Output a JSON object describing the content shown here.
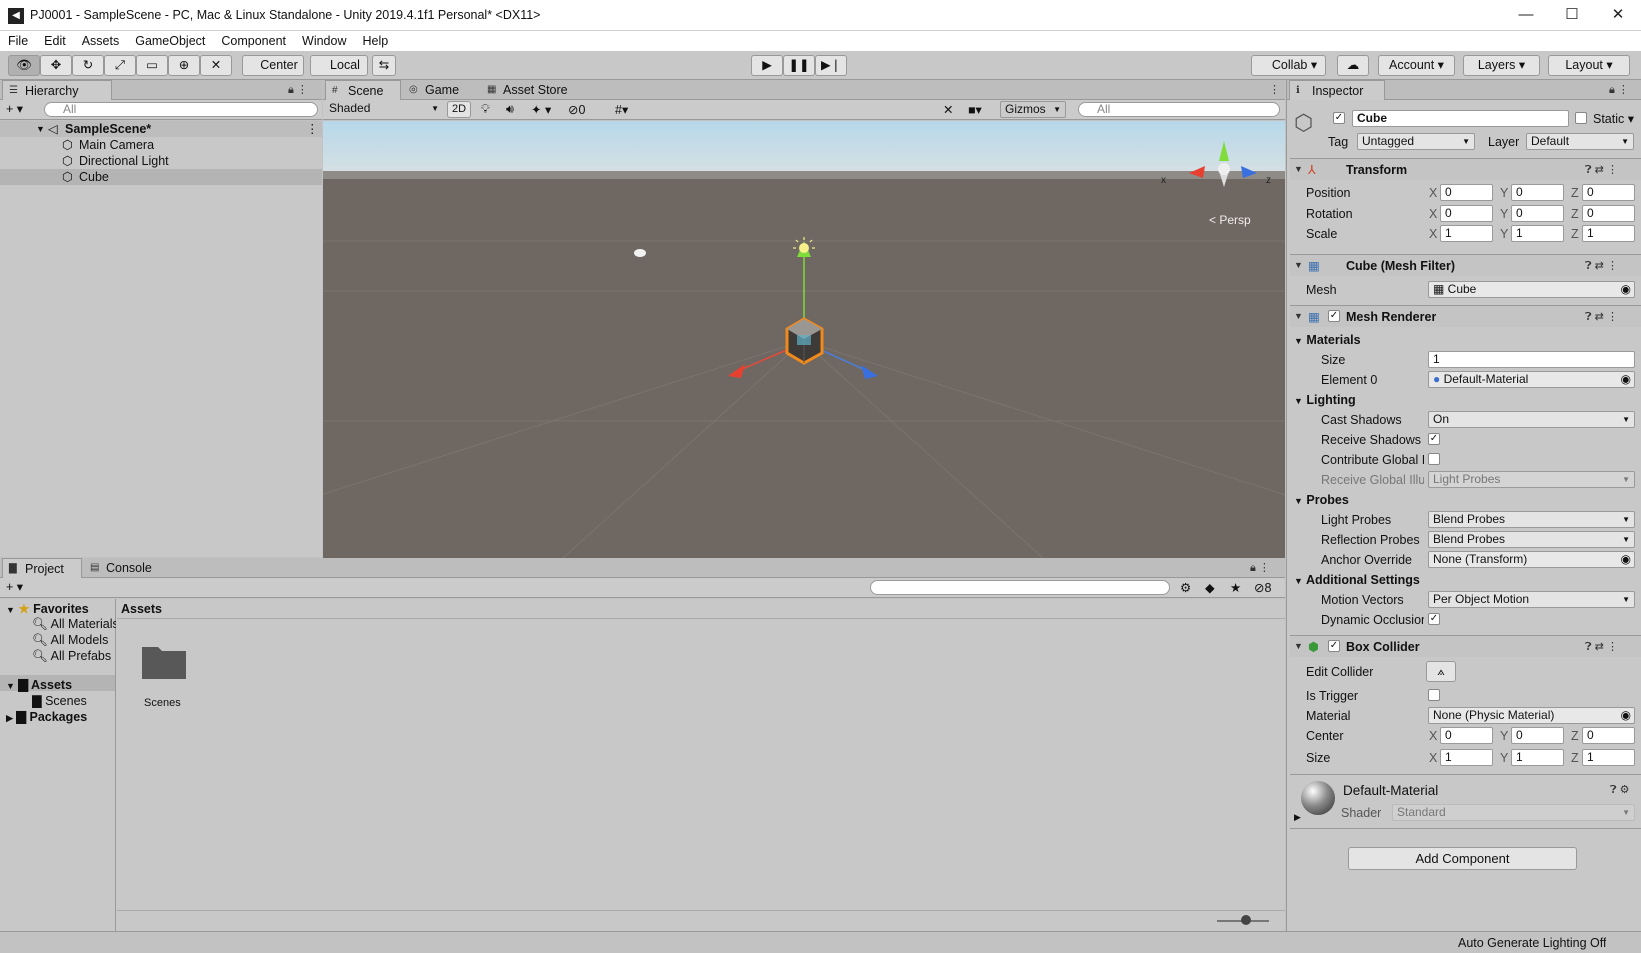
{
  "window": {
    "title": "PJ0001 - SampleScene - PC, Mac & Linux Standalone - Unity 2019.4.1f1 Personal* <DX11>",
    "minimize": "—",
    "maximize": "☐",
    "close": "✕"
  },
  "menu": [
    "File",
    "Edit",
    "Assets",
    "GameObject",
    "Component",
    "Window",
    "Help"
  ],
  "toolbar": {
    "pivot": "Center",
    "space": "Local",
    "collab": "Collab",
    "account": "Account",
    "layers": "Layers",
    "layout": "Layout"
  },
  "hierarchy": {
    "tab": "Hierarchy",
    "search_placeholder": "All",
    "scene": "SampleScene*",
    "items": [
      "Main Camera",
      "Directional Light",
      "Cube"
    ]
  },
  "scene_view": {
    "tabs": [
      "Scene",
      "Game",
      "Asset Store"
    ],
    "shading": "Shaded",
    "mode2d": "2D",
    "hidden_count": "0",
    "gizmos": "Gizmos",
    "search_placeholder": "All",
    "persp": "< Persp",
    "axis_x": "x",
    "axis_z": "z"
  },
  "project": {
    "tabs": [
      "Project",
      "Console"
    ],
    "favorites": "Favorites",
    "favorite_items": [
      "All Materials",
      "All Models",
      "All Prefabs"
    ],
    "assets_root": "Assets",
    "assets_children": [
      "Scenes"
    ],
    "packages": "Packages",
    "breadcrumb": "Assets",
    "folders": [
      "Scenes"
    ],
    "badge": "8"
  },
  "inspector": {
    "tab": "Inspector",
    "object_name": "Cube",
    "static": "Static",
    "tag_label": "Tag",
    "tag": "Untagged",
    "layer_label": "Layer",
    "layer": "Default",
    "transform": {
      "title": "Transform",
      "rows": [
        {
          "label": "Position",
          "x": "0",
          "y": "0",
          "z": "0"
        },
        {
          "label": "Rotation",
          "x": "0",
          "y": "0",
          "z": "0"
        },
        {
          "label": "Scale",
          "x": "1",
          "y": "1",
          "z": "1"
        }
      ]
    },
    "mesh_filter": {
      "title": "Cube (Mesh Filter)",
      "mesh_label": "Mesh",
      "mesh": "Cube"
    },
    "mesh_renderer": {
      "title": "Mesh Renderer",
      "materials": "Materials",
      "size_label": "Size",
      "size": "1",
      "element0_label": "Element 0",
      "element0": "Default-Material",
      "lighting": "Lighting",
      "cast_shadows_label": "Cast Shadows",
      "cast_shadows": "On",
      "receive_shadows_label": "Receive Shadows",
      "contribute_gi_label": "Contribute Global I",
      "receive_gi_label": "Receive Global Illu",
      "receive_gi": "Light Probes",
      "probes": "Probes",
      "light_probes_label": "Light Probes",
      "light_probes": "Blend Probes",
      "reflection_probes_label": "Reflection Probes",
      "reflection_probes": "Blend Probes",
      "anchor_label": "Anchor Override",
      "anchor": "None (Transform)",
      "additional": "Additional Settings",
      "motion_label": "Motion Vectors",
      "motion": "Per Object Motion",
      "dynamic_label": "Dynamic Occlusion"
    },
    "box_collider": {
      "title": "Box Collider",
      "edit_label": "Edit Collider",
      "trigger_label": "Is Trigger",
      "material_label": "Material",
      "material": "None (Physic Material)",
      "center_label": "Center",
      "cx": "0",
      "cy": "0",
      "cz": "0",
      "size_label": "Size",
      "sx": "1",
      "sy": "1",
      "sz": "1"
    },
    "material": {
      "name": "Default-Material",
      "shader_label": "Shader",
      "shader": "Standard"
    },
    "add_component": "Add Component"
  },
  "status": "Auto Generate Lighting Off",
  "axis_labels": {
    "x": "X",
    "y": "Y",
    "z": "Z"
  }
}
